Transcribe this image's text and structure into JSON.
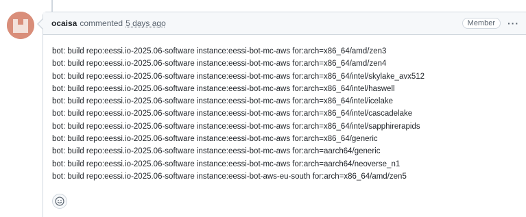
{
  "comment": {
    "author": "ocaisa",
    "action": "commented",
    "time": "5 days ago",
    "badge": "Member",
    "menu_icon": "kebab-horizontal-icon",
    "lines": [
      "bot: build repo:eessi.io-2025.06-software instance:eessi-bot-mc-aws for:arch=x86_64/amd/zen3",
      "bot: build repo:eessi.io-2025.06-software instance:eessi-bot-mc-aws for:arch=x86_64/amd/zen4",
      "bot: build repo:eessi.io-2025.06-software instance:eessi-bot-mc-aws for:arch=x86_64/intel/skylake_avx512",
      "bot: build repo:eessi.io-2025.06-software instance:eessi-bot-mc-aws for:arch=x86_64/intel/haswell",
      "bot: build repo:eessi.io-2025.06-software instance:eessi-bot-mc-aws for:arch=x86_64/intel/icelake",
      "bot: build repo:eessi.io-2025.06-software instance:eessi-bot-mc-aws for:arch=x86_64/intel/cascadelake",
      "bot: build repo:eessi.io-2025.06-software instance:eessi-bot-mc-aws for:arch=x86_64/intel/sapphirerapids",
      "bot: build repo:eessi.io-2025.06-software instance:eessi-bot-mc-aws for:arch=x86_64/generic",
      "bot: build repo:eessi.io-2025.06-software instance:eessi-bot-mc-aws for:arch=aarch64/generic",
      "bot: build repo:eessi.io-2025.06-software instance:eessi-bot-mc-aws for:arch=aarch64/neoverse_n1",
      "bot: build repo:eessi.io-2025.06-software instance:eessi-bot-aws-eu-south for:arch=x86_64/amd/zen5"
    ],
    "reaction_icon": "smiley-icon"
  },
  "colors": {
    "border": "#d0d7de",
    "header_bg": "#f6f8fa",
    "muted_text": "#59636e",
    "avatar_bg": "#d98e7a"
  }
}
